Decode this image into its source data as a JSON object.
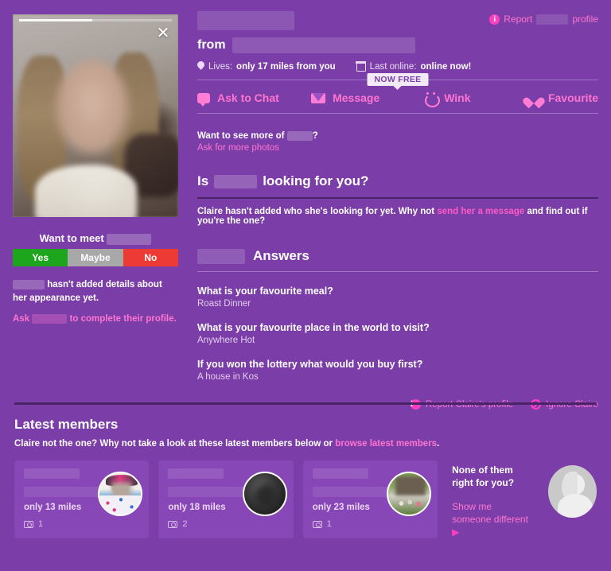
{
  "profile": {
    "name_redacted": true,
    "from_label": "from",
    "lives_label": "Lives:",
    "lives_value": "only 17 miles from you",
    "last_online_label": "Last online:",
    "last_online_value": "online now!",
    "now_free_badge": "NOW FREE",
    "report_top_prefix": "Report",
    "report_top_suffix": "profile"
  },
  "actions": [
    {
      "label": "Ask to Chat",
      "icon": "chat-bubble-icon"
    },
    {
      "label": "Message",
      "icon": "envelope-icon"
    },
    {
      "label": "Wink",
      "icon": "wink-face-icon"
    },
    {
      "label": "Favourite",
      "icon": "heart-icon"
    }
  ],
  "see_more": {
    "question_prefix": "Want to see more of",
    "question_suffix": "?",
    "link": "Ask for more photos"
  },
  "looking_for": {
    "heading_prefix": "Is",
    "heading_suffix": "looking for you?",
    "body_before": "Claire hasn't added who she's looking for yet. Why not",
    "body_link": "send her a message",
    "body_after": "and find out if you're the one?"
  },
  "answers": {
    "heading": "Answers",
    "items": [
      {
        "question": "What is your favourite meal?",
        "answer": "Roast Dinner"
      },
      {
        "question": "What is your favourite place in the world to visit?",
        "answer": "Anywhere Hot"
      },
      {
        "question": "If you won the lottery what would you buy first?",
        "answer": "A house in Kos"
      }
    ]
  },
  "report_bottom": {
    "report": "Report Claire's profile",
    "ignore": "Ignore Claire"
  },
  "sidebar": {
    "want_to_meet_label": "Want to meet",
    "buttons": {
      "yes": "Yes",
      "maybe": "Maybe",
      "no": "No"
    },
    "appearance_note_suffix": "hasn't added details about her appearance yet.",
    "ask_prefix": "Ask",
    "ask_suffix": "to complete their profile."
  },
  "latest_members": {
    "title": "Latest members",
    "subtitle_before": "Claire not the one? Why not take a look at these latest members below or",
    "subtitle_link": "browse latest members",
    "subtitle_after": ".",
    "cards": [
      {
        "miles": "only 13 miles",
        "photos": "1"
      },
      {
        "miles": "only 18 miles",
        "photos": "2"
      },
      {
        "miles": "only 23 miles",
        "photos": "1"
      }
    ],
    "none_right": "None of them right for you?",
    "show_different": "Show me someone different",
    "show_different_arrow": "▶"
  },
  "colors": {
    "background": "#7B3EA8",
    "accent_pink": "#FF74D0",
    "bright_pink": "#FF3FC0",
    "yes_green": "#1DA51D",
    "maybe_gray": "#A8A8A8",
    "no_red": "#EE3A35",
    "divider_dark": "#4A2266",
    "card_bg": "#8847B6"
  }
}
